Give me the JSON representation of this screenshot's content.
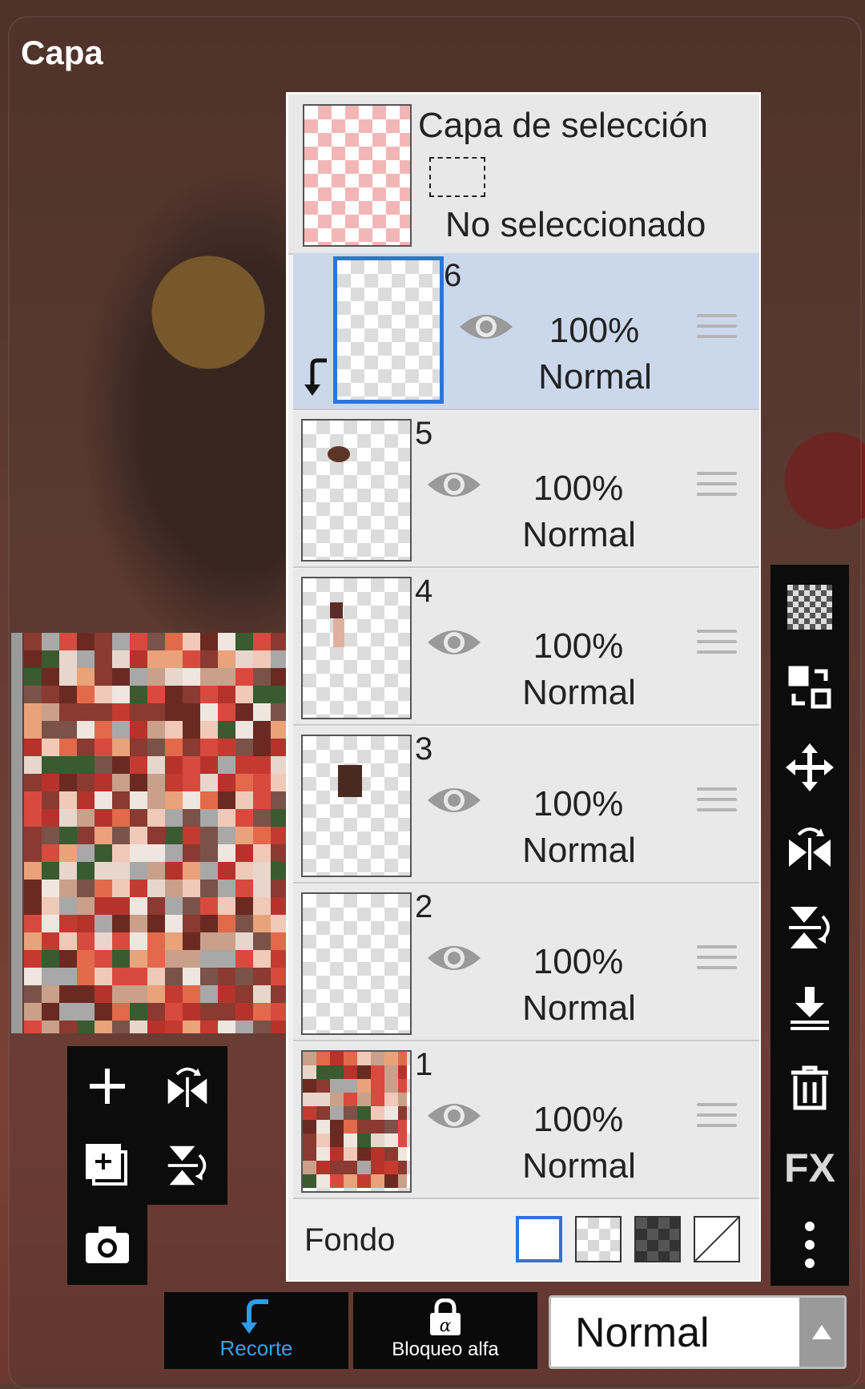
{
  "title": "Capa",
  "selection_layer": {
    "title": "Capa de selección",
    "status": "No seleccionado"
  },
  "layers": [
    {
      "number": "6",
      "opacity": "100%",
      "mode": "Normal",
      "active": true
    },
    {
      "number": "5",
      "opacity": "100%",
      "mode": "Normal",
      "active": false
    },
    {
      "number": "4",
      "opacity": "100%",
      "mode": "Normal",
      "active": false
    },
    {
      "number": "3",
      "opacity": "100%",
      "mode": "Normal",
      "active": false
    },
    {
      "number": "2",
      "opacity": "100%",
      "mode": "Normal",
      "active": false
    },
    {
      "number": "1",
      "opacity": "100%",
      "mode": "Normal",
      "active": false
    }
  ],
  "background": {
    "label": "Fondo"
  },
  "right_toolbar": {
    "icons": [
      "transparency-icon",
      "swap-layer-icon",
      "move-icon",
      "flip-horizontal-icon",
      "flip-vertical-icon",
      "merge-down-icon",
      "trash-icon",
      "fx-icon",
      "more-icon"
    ],
    "fx_label": "FX"
  },
  "left_toolbar": {
    "icons": [
      "add-layer-icon",
      "flip-horizontal-icon",
      "duplicate-layer-icon",
      "flip-vertical-icon",
      "camera-icon"
    ]
  },
  "bottom_bar": {
    "clipping_label": "Recorte",
    "alpha_lock_label": "Bloqueo alfa",
    "blend_mode": "Normal"
  },
  "colors": {
    "accent": "#2f74d8",
    "selection_check": "#f3b6b6",
    "active_row": "#cbd8ec"
  }
}
